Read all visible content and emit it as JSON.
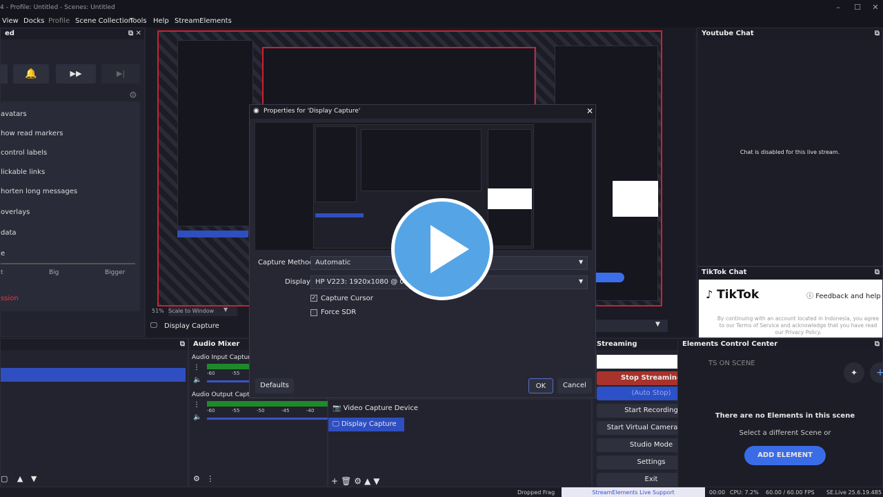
{
  "window": {
    "title": "4 - Profile: Untitled - Scenes: Untitled",
    "min": "–",
    "max": "☐",
    "close": "✕"
  },
  "menu": [
    "View",
    "Docks",
    "Profile",
    "Scene Collection",
    "Tools",
    "Help",
    "StreamElements"
  ],
  "left_panel": {
    "title": "ed",
    "items": [
      "avatars",
      "how read markers",
      "control labels",
      "lickable links",
      "horten long messages",
      "overlays",
      "data",
      "e"
    ],
    "sizes": [
      "t",
      "Big",
      "Bigger"
    ],
    "session": "ssion"
  },
  "preview": {
    "zoom": "51%",
    "scale_mode": "Scale to Window",
    "source": "Display Capture"
  },
  "youtube_chat": {
    "title": "Youtube Chat",
    "message": "Chat is disabled for this live stream."
  },
  "tiktok_chat": {
    "title": "TikTok Chat",
    "logo": "TikTok",
    "feedback": "Feedback and help",
    "notice": "By continuing with an account located in Indonesia, you agree to our Terms of Service and acknowledge that you have read our Privacy Policy."
  },
  "dialog": {
    "title": "Properties for 'Display Capture'",
    "capture_method_label": "Capture Method",
    "capture_method_value": "Automatic",
    "display_label": "Display",
    "display_value": "HP V223: 1920x1080 @ 0,0 (Prim",
    "capture_cursor": "Capture Cursor",
    "force_sdr": "Force SDR",
    "defaults": "Defaults",
    "ok": "OK",
    "cancel": "Cancel"
  },
  "audio_mixer": {
    "title": "Audio Mixer",
    "input": "Audio Input Captur",
    "output": "Audio Output Captu",
    "ticks": [
      "-60",
      "-55",
      "-50",
      "-45",
      "-40"
    ]
  },
  "sources": [
    "Video Capture Device",
    "Display Capture"
  ],
  "controls": {
    "title": "Streaming",
    "stop": "Stop Streaming",
    "autostop": "(Auto Stop)",
    "record": "Start Recording",
    "vcam": "Start Virtual Camera",
    "studio": "Studio Mode",
    "settings": "Settings",
    "exit": "Exit"
  },
  "elements": {
    "title": "Elements Control Center",
    "heading": "TS ON SCENE",
    "empty": "There are no Elements in this scene",
    "hint": "Select a different Scene or",
    "add": "ADD ELEMENT"
  },
  "status": {
    "dropped": "Dropped Frag",
    "se_support": "StreamElements Live Support",
    "time": "00:00",
    "cpu": "CPU: 7.2%",
    "fps": "60.00 / 60.00 FPS",
    "se": "SE.Live 25.6.19.485"
  }
}
